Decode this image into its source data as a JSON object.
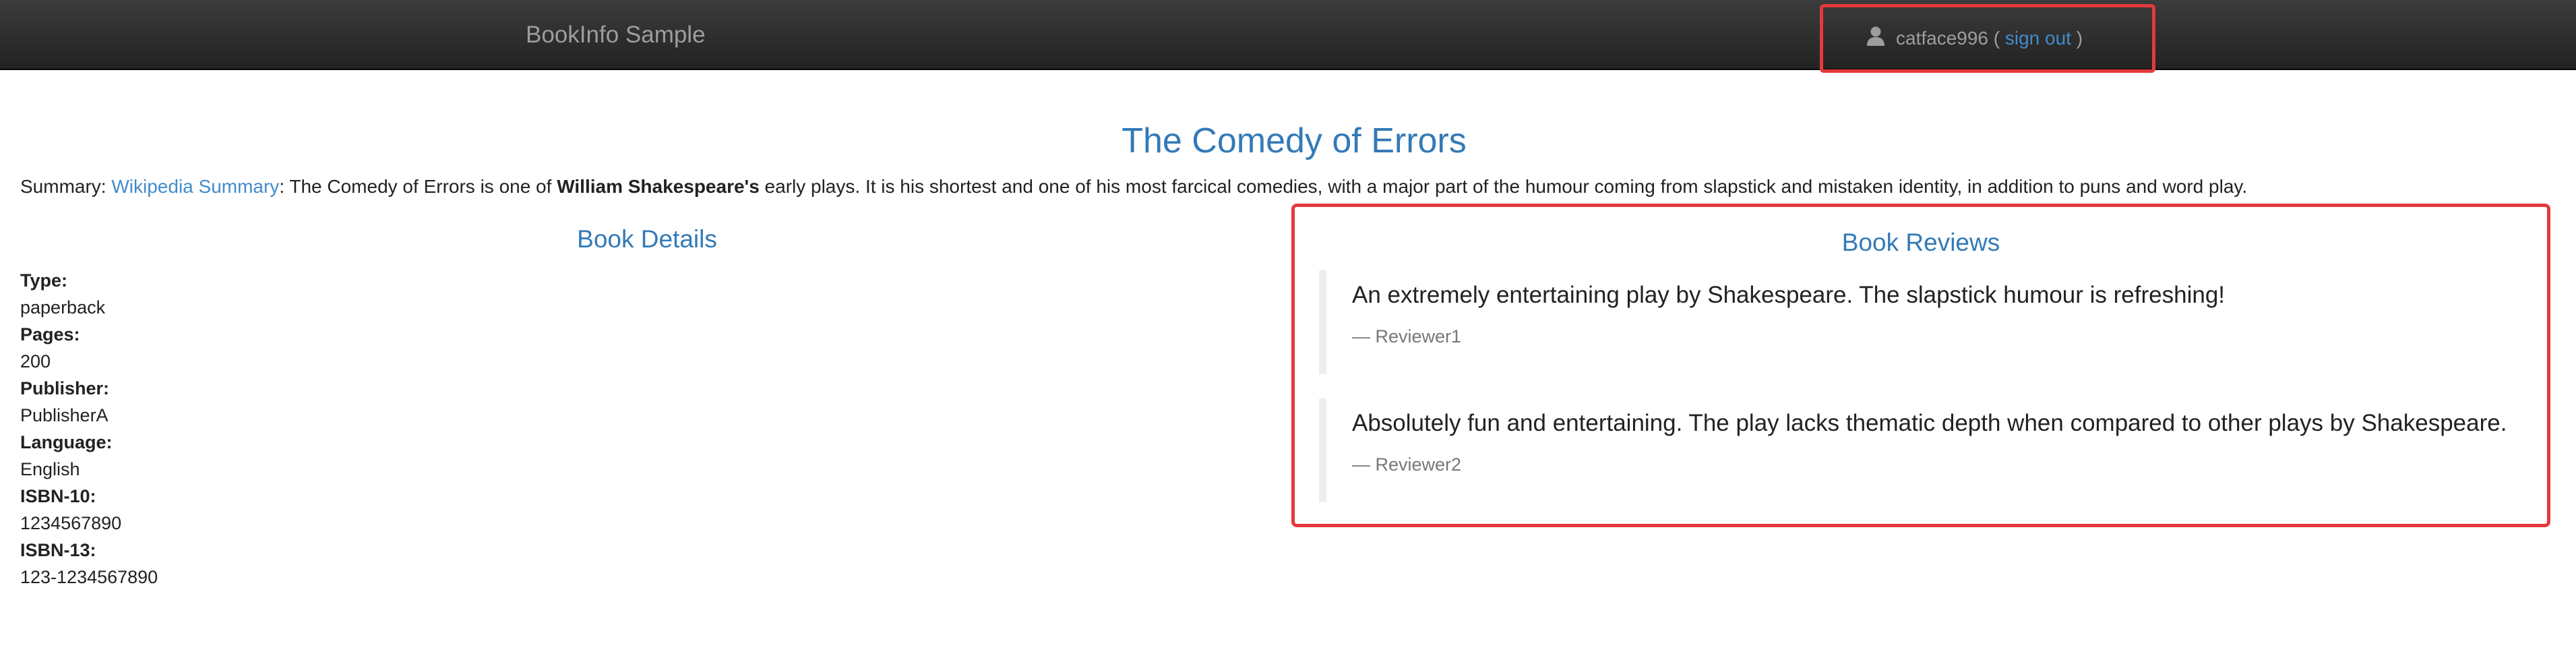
{
  "navbar": {
    "brand": "BookInfo Sample",
    "user": {
      "icon": "user-icon",
      "username": "catface996",
      "open_paren": " ( ",
      "signout_label": "sign out",
      "close_paren": " )"
    }
  },
  "book": {
    "title": "The Comedy of Errors",
    "summary": {
      "prefix": "Summary: ",
      "link_label": "Wikipedia Summary",
      "text_before_bold": ": The Comedy of Errors is one of ",
      "bold": "William Shakespeare's",
      "text_after_bold": " early plays. It is his shortest and one of his most farcical comedies, with a major part of the humour coming from slapstick and mistaken identity, in addition to puns and word play."
    }
  },
  "details": {
    "heading": "Book Details",
    "fields": [
      {
        "label": "Type:",
        "value": "paperback"
      },
      {
        "label": "Pages:",
        "value": "200"
      },
      {
        "label": "Publisher:",
        "value": "PublisherA"
      },
      {
        "label": "Language:",
        "value": "English"
      },
      {
        "label": "ISBN-10:",
        "value": "1234567890"
      },
      {
        "label": "ISBN-13:",
        "value": "123-1234567890"
      }
    ]
  },
  "reviews": {
    "heading": "Book Reviews",
    "items": [
      {
        "text": "An extremely entertaining play by Shakespeare. The slapstick humour is refreshing!",
        "author": "— Reviewer1"
      },
      {
        "text": "Absolutely fun and entertaining. The play lacks thematic depth when compared to other plays by Shakespeare.",
        "author": "— Reviewer2"
      }
    ]
  },
  "colors": {
    "navbar_bg": "#222222",
    "brand_text": "#9d9d9d",
    "link": "#428bca",
    "heading": "#337ab7",
    "highlight_border": "#e5393c",
    "review_author": "#777777"
  }
}
